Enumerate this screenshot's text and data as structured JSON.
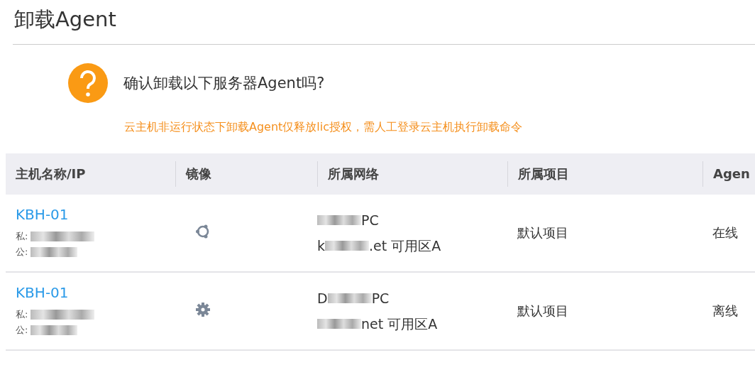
{
  "dialog": {
    "title": "卸载Agent",
    "question": "确认卸载以下服务器Agent吗?",
    "warning": "云主机非运行状态下卸载Agent仅释放lic授权，需人工登录云主机执行卸载命令"
  },
  "table": {
    "columns": [
      "主机名称/IP",
      "镜像",
      "所属网络",
      "所属项目",
      "Agen"
    ],
    "rows": [
      {
        "name": "KBH-01",
        "private_label": "私:",
        "public_label": "公:",
        "image": {
          "kind": "ubuntu"
        },
        "network": [
          [
            {
              "kind": "redacted"
            },
            {
              "kind": "text",
              "text": "PC"
            }
          ],
          [
            {
              "kind": "text",
              "text": "k"
            },
            {
              "kind": "redacted"
            },
            {
              "kind": "text",
              "text": ".et 可用区A"
            }
          ]
        ],
        "project": "默认项目",
        "status": "在线"
      },
      {
        "name": "KBH-01",
        "private_label": "私:",
        "public_label": "公:",
        "image": {
          "kind": "gear"
        },
        "network": [
          [
            {
              "kind": "text",
              "text": "D"
            },
            {
              "kind": "redacted"
            },
            {
              "kind": "text",
              "text": "PC"
            }
          ],
          [
            {
              "kind": "redacted"
            },
            {
              "kind": "text",
              "text": "net 可用区A"
            }
          ]
        ],
        "project": "默认项目",
        "status": "离线"
      }
    ]
  }
}
